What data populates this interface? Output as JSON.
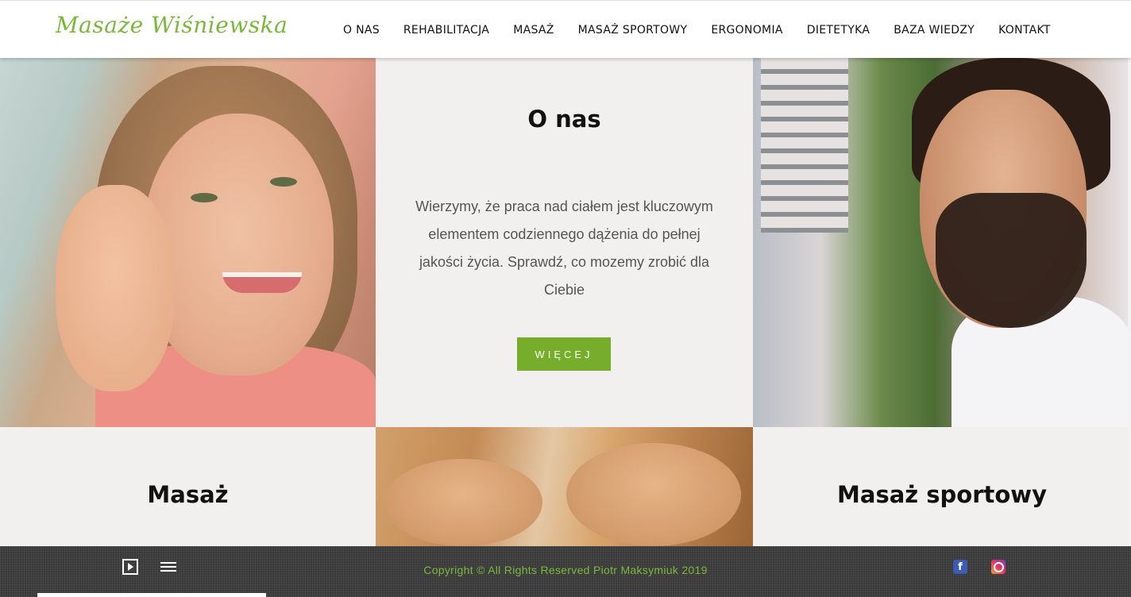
{
  "header": {
    "logo": "Masaże Wiśniewska",
    "nav": [
      "O NAS",
      "REHABILITACJA",
      "MASAŻ",
      "MASAŻ SPORTOWY",
      "ERGONOMIA",
      "DIETETYKA",
      "BAZA WIEDZY",
      "KONTAKT"
    ]
  },
  "about": {
    "title": "O nas",
    "text": "Wierzymy, że praca nad ciałem jest kluczowym elementem codziennego dążenia do pełnej jakości życia. Sprawdź, co mozemy zrobić dla Ciebie",
    "button": "WIĘCEJ"
  },
  "tiles": {
    "masaz": "Masaż",
    "sport": "Masaż sportowy"
  },
  "footer": {
    "copyright": "Copyright © All Rights Reserved Piotr Maksymiuk 2019",
    "facebook_glyph": "f"
  },
  "icons": {
    "play": "play-icon",
    "playlist": "playlist-icon",
    "facebook": "facebook-icon",
    "instagram": "instagram-icon"
  },
  "colors": {
    "accent": "#76ad2a",
    "logo": "#7ab83a",
    "footer": "#3a3a3a",
    "panel": "#f2efef"
  }
}
